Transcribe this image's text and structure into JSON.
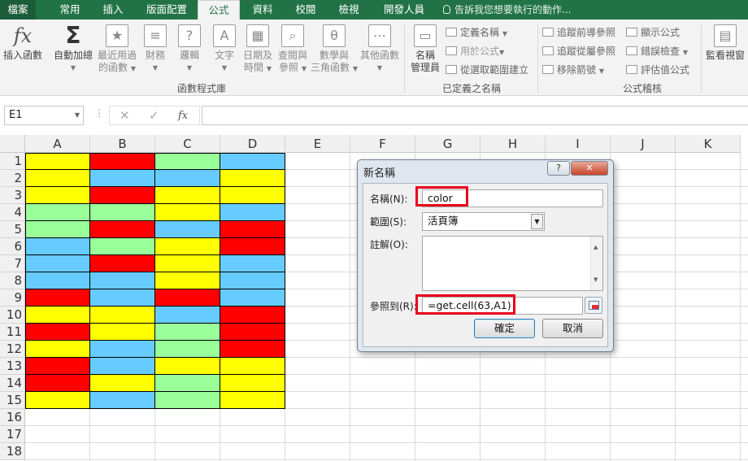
{
  "tabs": [
    "檔案",
    "常用",
    "插入",
    "版面配置",
    "公式",
    "資料",
    "校閱",
    "檢視",
    "開發人員"
  ],
  "tell_me": "告訴我您想要執行的動作...",
  "ribbon": {
    "insert_function": "插入函數",
    "autosum": "自動加總",
    "recent": "最近用過",
    "recent2": "的函數",
    "financial": "財務",
    "logical": "邏輯",
    "text": "文字",
    "datetime": "日期及",
    "datetime2": "時間",
    "lookup": "查閱與",
    "lookup2": "參照",
    "math": "數學與",
    "math2": "三角函數",
    "more": "其他函數",
    "library_label": "函數程式庫",
    "name_manager": "名稱",
    "name_manager2": "管理員",
    "define_name": "定義名稱",
    "use_in_formula": "用於公式",
    "create_from_selection": "從選取範圍建立",
    "defined_names_label": "已定義之名稱",
    "trace_precedents": "追蹤前導參照",
    "trace_dependents": "追蹤從屬參照",
    "remove_arrows": "移除箭號",
    "show_formulas": "顯示公式",
    "error_checking": "錯誤檢查",
    "evaluate_formula": "評估值公式",
    "auditing_label": "公式稽核",
    "watch_window": "監看視窗"
  },
  "formula_bar": {
    "name_box": "E1",
    "cancel": "✕",
    "enter": "✓",
    "fx": "fx",
    "formula": ""
  },
  "grid": {
    "columns": [
      "A",
      "B",
      "C",
      "D",
      "E",
      "F",
      "G",
      "H",
      "I",
      "J",
      "K"
    ],
    "rows": [
      "1",
      "2",
      "3",
      "4",
      "5",
      "6",
      "7",
      "8",
      "9",
      "10",
      "11",
      "12",
      "13",
      "14",
      "15",
      "16",
      "17",
      "18"
    ],
    "colors": {
      "Y": "#ffff00",
      "R": "#ff0000",
      "G": "#99ff99",
      "B": "#66ccff"
    },
    "fill": [
      [
        "Y",
        "R",
        "G",
        "B"
      ],
      [
        "Y",
        "B",
        "B",
        "Y"
      ],
      [
        "Y",
        "R",
        "Y",
        "Y"
      ],
      [
        "G",
        "G",
        "Y",
        "B"
      ],
      [
        "G",
        "R",
        "B",
        "R"
      ],
      [
        "B",
        "G",
        "Y",
        "R"
      ],
      [
        "B",
        "R",
        "Y",
        "B"
      ],
      [
        "B",
        "B",
        "Y",
        "B"
      ],
      [
        "R",
        "B",
        "R",
        "B"
      ],
      [
        "Y",
        "Y",
        "B",
        "R"
      ],
      [
        "R",
        "Y",
        "G",
        "R"
      ],
      [
        "Y",
        "B",
        "G",
        "R"
      ],
      [
        "R",
        "B",
        "Y",
        "Y"
      ],
      [
        "R",
        "Y",
        "G",
        "Y"
      ],
      [
        "Y",
        "B",
        "G",
        "Y"
      ]
    ]
  },
  "dialog": {
    "title": "新名稱",
    "help": "?",
    "close": "✕",
    "name_label": "名稱(N):",
    "name_value": "color",
    "scope_label": "範圍(S):",
    "scope_value": "活頁簿",
    "comment_label": "註解(O):",
    "refers_label": "參照到(R):",
    "refers_value": "=get.cell(63,A1)",
    "ok": "確定",
    "cancel": "取消"
  }
}
